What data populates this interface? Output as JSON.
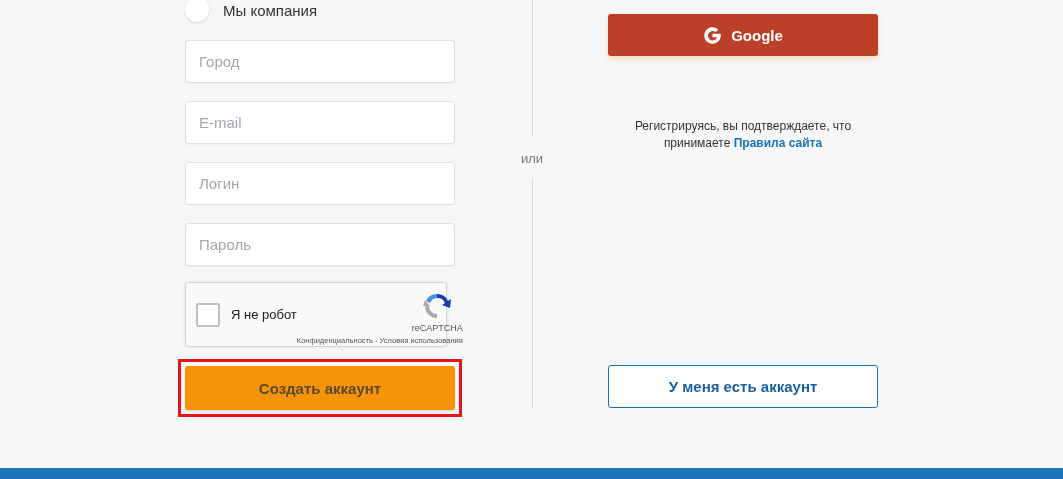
{
  "account_type": {
    "label": "Мы компания",
    "selected": false
  },
  "fields": [
    {
      "placeholder": "Город"
    },
    {
      "placeholder": "E-mail"
    },
    {
      "placeholder": "Логин"
    },
    {
      "placeholder": "Пароль"
    }
  ],
  "captcha": {
    "label": "Я не робот",
    "checked": false,
    "brand": "reCAPTCHA",
    "links": "Конфиденциальность - Условия использования"
  },
  "create_button": {
    "label": "Создать аккаунт",
    "highlighted": true
  },
  "divider": "или",
  "google_button": {
    "label": "Google"
  },
  "terms": {
    "text": "Регистрируясь, вы подтверждаете, что принимаете",
    "link": "Правила сайта"
  },
  "login_button": {
    "label": "У меня есть аккаунт"
  }
}
